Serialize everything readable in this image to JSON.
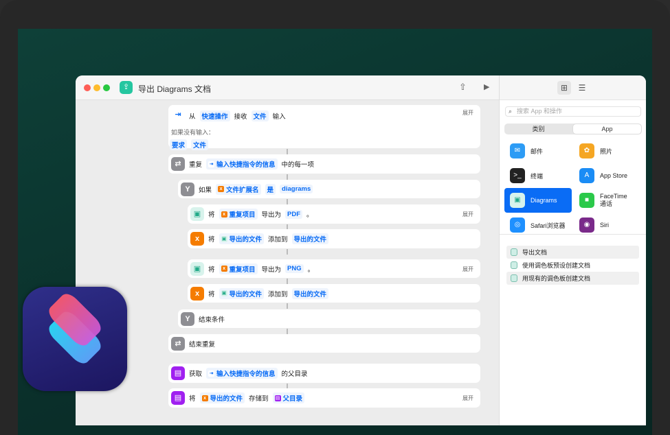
{
  "window": {
    "title": "导出 Diagrams 文档",
    "share_icon": "share-icon",
    "run_icon": "play-icon"
  },
  "colors": {
    "accent": "#0a6cf5",
    "teal": "#25c6a0",
    "orange": "#f57c00",
    "purple": "#a020f0",
    "gray": "#8e8e93"
  },
  "actions": [
    {
      "indent": 0,
      "icon": "input",
      "tokens": [
        {
          "t": "从"
        },
        {
          "p": "快速操作"
        },
        {
          "t": "接收"
        },
        {
          "p": "文件"
        },
        {
          "t": "输入"
        }
      ],
      "expand": "展开",
      "sub_label": "如果没有输入：",
      "sub_tokens": [
        {
          "p": "要求"
        },
        {
          "p": "文件"
        }
      ]
    },
    {
      "indent": 0,
      "icon": "repeat",
      "tokens": [
        {
          "t": "重复"
        },
        {
          "p": "输入快捷指令的信息",
          "m": "input"
        },
        {
          "t": "中的每一项"
        }
      ]
    },
    {
      "indent": 1,
      "icon": "if",
      "tokens": [
        {
          "t": "如果"
        },
        {
          "p": "文件扩展名",
          "m": "var"
        },
        {
          "p": "是"
        },
        {
          "p": "diagrams"
        }
      ]
    },
    {
      "indent": 2,
      "icon": "diagrams",
      "tokens": [
        {
          "t": "将"
        },
        {
          "p": "重复项目",
          "m": "var"
        },
        {
          "t": "导出为"
        },
        {
          "p": "PDF"
        },
        {
          "t": "。"
        }
      ],
      "expand": "展开"
    },
    {
      "indent": 2,
      "icon": "var",
      "tokens": [
        {
          "t": "将"
        },
        {
          "p": "导出的文件",
          "m": "diagrams"
        },
        {
          "t": "添加到"
        },
        {
          "p": "导出的文件"
        }
      ]
    },
    {
      "indent": 2,
      "icon": "diagrams",
      "tokens": [
        {
          "t": "将"
        },
        {
          "p": "重复项目",
          "m": "var"
        },
        {
          "t": "导出为"
        },
        {
          "p": "PNG"
        },
        {
          "t": "。"
        }
      ],
      "expand": "展开"
    },
    {
      "indent": 2,
      "icon": "var",
      "tokens": [
        {
          "t": "将"
        },
        {
          "p": "导出的文件",
          "m": "diagrams"
        },
        {
          "t": "添加到"
        },
        {
          "p": "导出的文件"
        }
      ]
    },
    {
      "indent": 1,
      "icon": "if",
      "tokens": [
        {
          "t": "结束条件"
        }
      ]
    },
    {
      "indent": 0,
      "icon": "repeat",
      "tokens": [
        {
          "t": "结束重复"
        }
      ]
    },
    {
      "indent": 0,
      "icon": "doc",
      "tokens": [
        {
          "t": "获取"
        },
        {
          "p": "输入快捷指令的信息",
          "m": "input"
        },
        {
          "t": "的父目录"
        }
      ]
    },
    {
      "indent": 0,
      "icon": "doc",
      "tokens": [
        {
          "t": "将"
        },
        {
          "p": "导出的文件",
          "m": "var"
        },
        {
          "t": "存储到"
        },
        {
          "p": "父目录",
          "m": "doc"
        }
      ],
      "expand": "展开"
    }
  ],
  "sidebar": {
    "search_placeholder": "搜索 App 和操作",
    "segments": [
      "类别",
      "App"
    ],
    "apps": [
      {
        "name": "邮件",
        "icon": "mail-icon",
        "color": "#2d9cf5",
        "glyph": "✉"
      },
      {
        "name": "照片",
        "icon": "photos-icon",
        "color": "#f5a623",
        "glyph": "✿"
      },
      {
        "name": "终端",
        "icon": "terminal-icon",
        "color": "#222222",
        "glyph": ">_"
      },
      {
        "name": "App Store",
        "icon": "app-store-icon",
        "color": "#1a8cf5",
        "glyph": "A"
      },
      {
        "name": "Diagrams",
        "icon": "diagrams-icon",
        "color": "#d8f3ec",
        "glyph": "▣",
        "selected": true
      },
      {
        "name": "FaceTime 通话",
        "icon": "facetime-icon",
        "color": "#2bc94a",
        "glyph": "■"
      },
      {
        "name": "Safari浏览器",
        "icon": "safari-icon",
        "color": "#1e90ff",
        "glyph": "◎"
      },
      {
        "name": "Siri",
        "icon": "siri-icon",
        "color": "#7a2a8a",
        "glyph": "◉"
      }
    ],
    "actions": [
      "导出文档",
      "使用调色板预设创建文档",
      "用现有的调色板创建文档"
    ]
  }
}
